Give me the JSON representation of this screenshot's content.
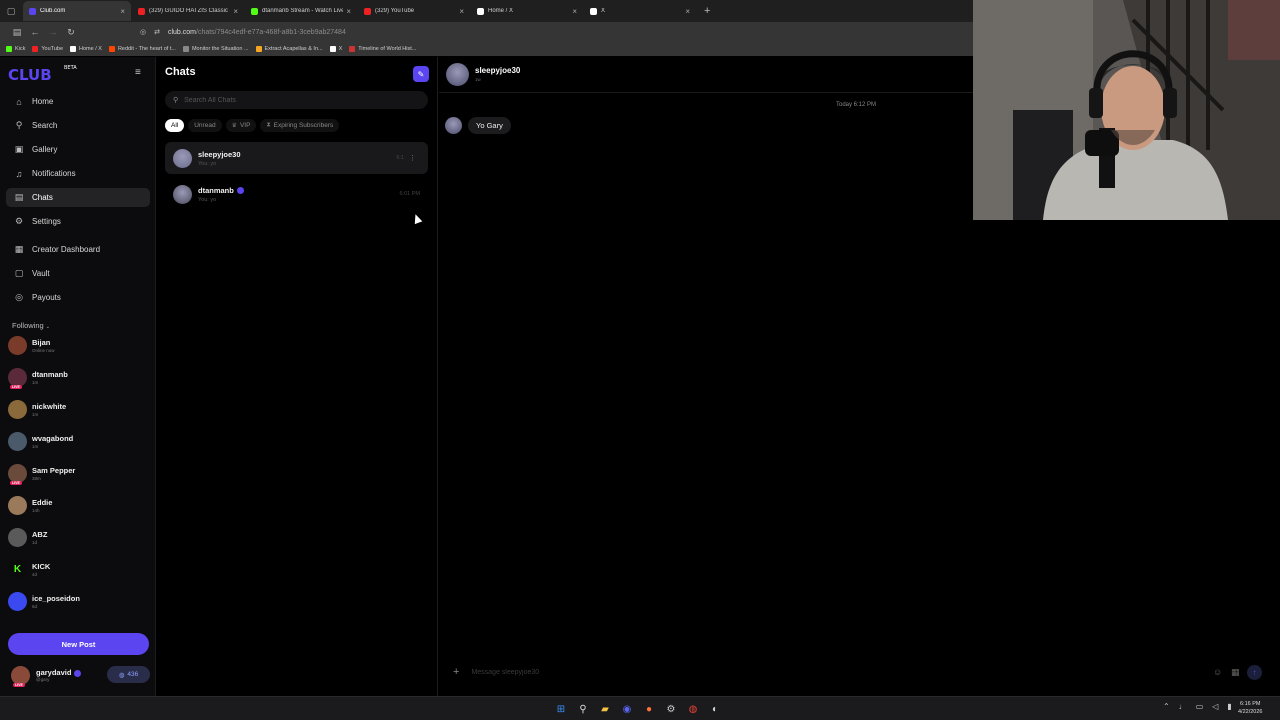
{
  "browser": {
    "tabs": [
      {
        "label": "Club.com",
        "active": true,
        "color": "#5b45f0"
      },
      {
        "label": "(329) GUIDO HATZIS Classic Ca",
        "active": false,
        "color": "#e22"
      },
      {
        "label": "dtanmanb Stream - Watch Live",
        "active": false,
        "color": "#53fc18"
      },
      {
        "label": "(329) YouTube",
        "active": false,
        "color": "#e22"
      },
      {
        "label": "Home / X",
        "active": false,
        "color": "#fff"
      },
      {
        "label": "X",
        "active": false,
        "color": "#fff"
      }
    ],
    "close_glyph": "×",
    "new_tab_glyph": "+",
    "url_host": "club.com",
    "url_path": "/chats/794c4edf-e77a-468f-a8b1-3ceb9ab27484",
    "bookmarks": [
      {
        "label": "Kick",
        "color": "#53fc18"
      },
      {
        "label": "YouTube",
        "color": "#e22"
      },
      {
        "label": "Home / X",
        "color": "#fff"
      },
      {
        "label": "Reddit - The heart of t...",
        "color": "#ff4500"
      },
      {
        "label": "Monitor the Situation ...",
        "color": "#888"
      },
      {
        "label": "Extract Acapellas & In...",
        "color": "#f5a623"
      },
      {
        "label": "X",
        "color": "#fff"
      },
      {
        "label": "Timeline of World Hist...",
        "color": "#c33"
      }
    ]
  },
  "sidebar": {
    "logo": "CLUB",
    "logo_badge": "BETA",
    "nav": [
      {
        "label": "Home",
        "icon": "home-icon",
        "glyph": "⌂"
      },
      {
        "label": "Search",
        "icon": "search-icon",
        "glyph": "⚲"
      },
      {
        "label": "Gallery",
        "icon": "gallery-icon",
        "glyph": "▣"
      },
      {
        "label": "Notifications",
        "icon": "bell-icon",
        "glyph": "♫"
      },
      {
        "label": "Chats",
        "icon": "chat-icon",
        "glyph": "▤",
        "active": true
      },
      {
        "label": "Settings",
        "icon": "gear-icon",
        "glyph": "⚙"
      },
      {
        "label": "Creator Dashboard",
        "icon": "dashboard-icon",
        "glyph": "▦"
      },
      {
        "label": "Vault",
        "icon": "vault-icon",
        "glyph": "▢"
      },
      {
        "label": "Payouts",
        "icon": "payouts-icon",
        "glyph": "◎"
      }
    ],
    "following_label": "Following",
    "following": [
      {
        "name": "Bijan",
        "sub": "Online now",
        "color": "#7a3b2a",
        "live": false
      },
      {
        "name": "dtanmanb",
        "sub": "1m",
        "color": "#5a2a3a",
        "live": true
      },
      {
        "name": "nickwhite",
        "sub": "1m",
        "color": "#8a6a3a",
        "live": false
      },
      {
        "name": "wvagabond",
        "sub": "1m",
        "color": "#4a5a6a",
        "live": false
      },
      {
        "name": "Sam Pepper",
        "sub": "38m",
        "color": "#6a4a3a",
        "live": true
      },
      {
        "name": "Eddie",
        "sub": "14h",
        "color": "#9a7a5a",
        "live": false
      },
      {
        "name": "ABZ",
        "sub": "1d",
        "color": "#5a5a5a",
        "live": false
      },
      {
        "name": "KICK",
        "sub": "4d",
        "color": "#0b0b0b",
        "live": false
      },
      {
        "name": "ice_poseidon",
        "sub": "6d",
        "color": "#3a4af0",
        "live": false
      }
    ],
    "new_post": "New Post",
    "me": {
      "name": "garydavid",
      "handle": "@gary",
      "points": "436"
    }
  },
  "chats": {
    "title": "Chats",
    "search_placeholder": "Search All Chats",
    "filters": [
      {
        "label": "All",
        "active": true,
        "icon": ""
      },
      {
        "label": "Unread",
        "active": false,
        "icon": ""
      },
      {
        "label": "VIP",
        "active": false,
        "icon": "♛"
      },
      {
        "label": "Expiring Subscribers",
        "active": false,
        "icon": "⧗"
      }
    ],
    "rows": [
      {
        "name": "sleepyjoe30",
        "preview": "You: yo",
        "time": "6:1",
        "active": true,
        "color": "#6a6a8a"
      },
      {
        "name": "dtanmanb",
        "preview": "You: yo",
        "time": "6:01 PM",
        "active": false,
        "color": "#4a4a5a",
        "verified": true
      }
    ]
  },
  "conversation": {
    "name": "sleepyjoe30",
    "sub": "1w",
    "date": "Today 6:12 PM",
    "messages": [
      {
        "text": "Yo Gary"
      }
    ],
    "composer_placeholder": "Message sleepyjoe30"
  },
  "taskbar": {
    "clock_time": "6:16 PM",
    "clock_date": "4/22/2026",
    "apps": [
      {
        "name": "start-icon",
        "glyph": "⊞",
        "color": "#3a8ef6"
      },
      {
        "name": "search-icon",
        "glyph": "⚲",
        "color": "#ddd"
      },
      {
        "name": "file-explorer-icon",
        "glyph": "▰",
        "color": "#f5c542"
      },
      {
        "name": "discord-icon",
        "glyph": "◉",
        "color": "#5865f2"
      },
      {
        "name": "firefox-icon",
        "glyph": "●",
        "color": "#ff7139"
      },
      {
        "name": "settings-icon",
        "glyph": "⚙",
        "color": "#ccc"
      },
      {
        "name": "chrome-icon",
        "glyph": "◍",
        "color": "#e94235"
      },
      {
        "name": "steam-icon",
        "glyph": "◐",
        "color": "#c7d5e0"
      }
    ]
  },
  "colors": {
    "accent": "#5b45f0",
    "live": "#e0245e"
  }
}
